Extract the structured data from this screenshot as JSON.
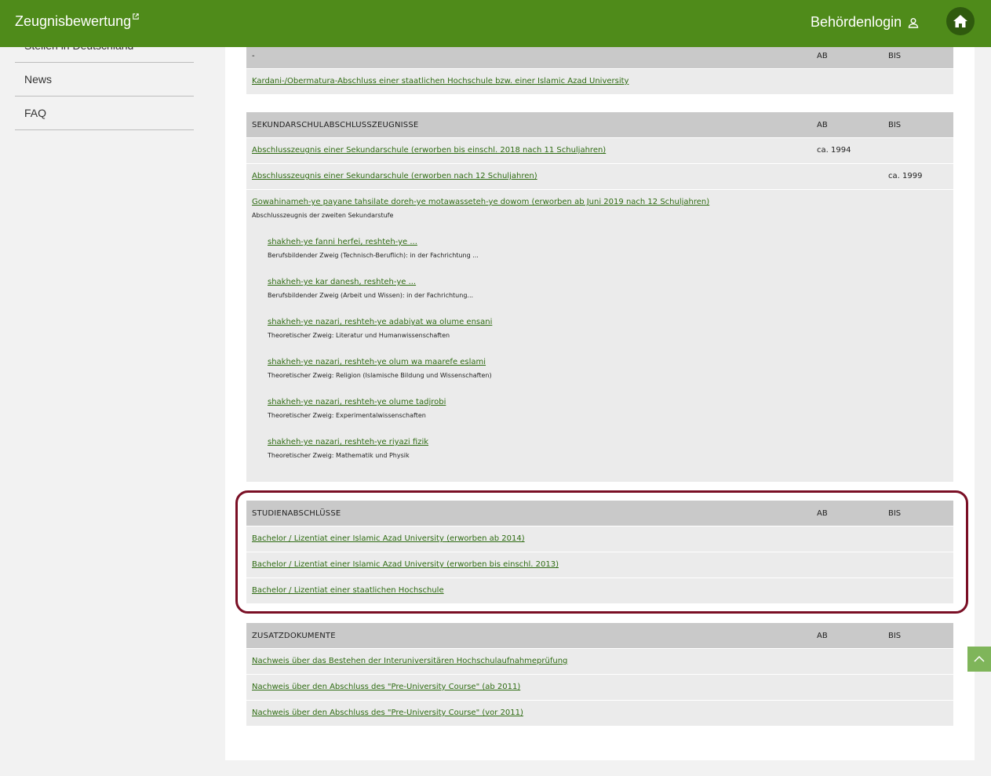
{
  "header": {
    "brand": "Zeugnisbewertung",
    "brand_ext_icon": "external-link-icon",
    "login": "Behördenlogin",
    "login_icon": "user-icon",
    "home_icon": "home-icon",
    "color": "#4f8b1a"
  },
  "sidebar": {
    "cut_item": "Stellen in Deutschland",
    "items": [
      {
        "label": "News"
      },
      {
        "label": "FAQ"
      }
    ]
  },
  "tables": [
    {
      "header": {
        "title": "-",
        "ab": "AB",
        "bis": "BIS"
      },
      "rows": [
        {
          "link": "Kardani-/Obermatura-Abschluss einer staatlichen Hochschule bzw. einer Islamic Azad University",
          "ab": "",
          "bis": ""
        }
      ]
    },
    {
      "header": {
        "title": "SEKUNDARSCHULABSCHLUSSZEUGNISSE",
        "ab": "AB",
        "bis": "BIS"
      },
      "rows": [
        {
          "link": "Abschlusszeugnis einer Sekundarschule (erworben bis einschl. 2018 nach 11 Schuljahren)",
          "ab": "ca. 1994",
          "bis": ""
        },
        {
          "link": "Abschlusszeugnis einer Sekundarschule (erworben nach 12 Schuljahren)",
          "ab": "",
          "bis": "ca. 1999"
        },
        {
          "link": "Gowahinameh-ye payane tahsilate doreh-ye motawasseteh-ye dowom (erworben ab Juni 2019 nach 12 Schuljahren)",
          "desc": "Abschlusszeugnis der zweiten Sekundarstufe",
          "subs": [
            {
              "link": "shakheh-ye fanni herfei, reshteh-ye ...",
              "desc": "Berufsbildender Zweig (Technisch-Beruflich): in der Fachrichtung ..."
            },
            {
              "link": "shakheh-ye kar danesh, reshteh-ye ...",
              "desc": "Berufsbildender Zweig (Arbeit und Wissen): in der Fachrichtung..."
            },
            {
              "link": "shakheh-ye nazari, reshteh-ye adabiyat wa olume ensani",
              "desc": "Theoretischer Zweig: Literatur und Humanwissenschaften"
            },
            {
              "link": "shakheh-ye nazari, reshteh-ye olum wa maarefe eslami",
              "desc": "Theoretischer Zweig: Religion (Islamische Bildung und Wissenschaften)"
            },
            {
              "link": "shakheh-ye nazari, reshteh-ye olume tadjrobi",
              "desc": "Theoretischer Zweig: Experimentalwissenschaften"
            },
            {
              "link": "shakheh-ye nazari, reshteh-ye riyazi fizik",
              "desc": "Theoretischer Zweig: Mathematik und Physik"
            }
          ]
        }
      ]
    },
    {
      "header": {
        "title": "STUDIENABSCHLÜSSE",
        "ab": "AB",
        "bis": "BIS"
      },
      "rows": [
        {
          "link": "Bachelor / Lizentiat einer Islamic Azad University (erworben ab 2014)",
          "ab": "",
          "bis": ""
        },
        {
          "link": "Bachelor / Lizentiat einer Islamic Azad University (erworben bis einschl. 2013)",
          "ab": "",
          "bis": ""
        },
        {
          "link": "Bachelor / Lizentiat einer staatlichen Hochschule",
          "ab": "",
          "bis": ""
        }
      ]
    },
    {
      "header": {
        "title": "ZUSATZDOKUMENTE",
        "ab": "AB",
        "bis": "BIS"
      },
      "rows": [
        {
          "link": "Nachweis über das Bestehen der Interuniversitären Hochschulaufnahmeprüfung",
          "ab": "",
          "bis": ""
        },
        {
          "link": "Nachweis über den Abschluss des \"Pre-University Course\" (ab 2011)",
          "ab": "",
          "bis": ""
        },
        {
          "link": "Nachweis über den Abschluss des \"Pre-University Course\" (vor 2011)",
          "ab": "",
          "bis": ""
        }
      ]
    }
  ],
  "highlight_color": "#7a0f25",
  "scroll_top_icon": "chevron-up-icon"
}
